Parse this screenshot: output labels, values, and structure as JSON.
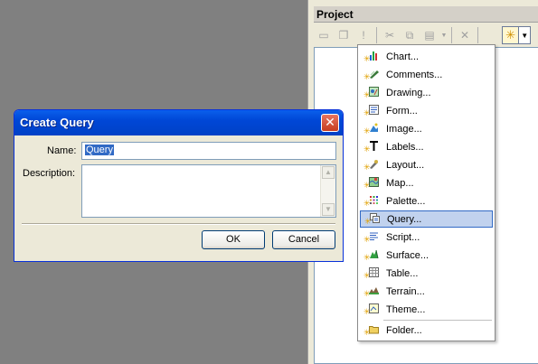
{
  "project_panel": {
    "title": "Project"
  },
  "new_menu": {
    "items": [
      {
        "label": "Chart...",
        "icon": "chart-icon"
      },
      {
        "label": "Comments...",
        "icon": "comments-icon"
      },
      {
        "label": "Drawing...",
        "icon": "drawing-icon"
      },
      {
        "label": "Form...",
        "icon": "form-icon"
      },
      {
        "label": "Image...",
        "icon": "image-icon"
      },
      {
        "label": "Labels...",
        "icon": "labels-icon"
      },
      {
        "label": "Layout...",
        "icon": "layout-icon"
      },
      {
        "label": "Map...",
        "icon": "map-icon"
      },
      {
        "label": "Palette...",
        "icon": "palette-icon"
      },
      {
        "label": "Query...",
        "icon": "query-icon",
        "selected": true
      },
      {
        "label": "Script...",
        "icon": "script-icon"
      },
      {
        "label": "Surface...",
        "icon": "surface-icon"
      },
      {
        "label": "Table...",
        "icon": "table-icon"
      },
      {
        "label": "Terrain...",
        "icon": "terrain-icon"
      },
      {
        "label": "Theme...",
        "icon": "theme-icon"
      },
      {
        "label": "Folder...",
        "icon": "folder-icon"
      }
    ]
  },
  "dialog": {
    "title": "Create Query",
    "close_glyph": "✕",
    "name_label": "Name:",
    "name_value": "Query",
    "description_label": "Description:",
    "description_value": "",
    "ok_label": "OK",
    "cancel_label": "Cancel"
  },
  "colors": {
    "titlebar_blue": "#0047d6",
    "selection_blue": "#316ac5",
    "menu_highlight": "#c1d2ee"
  }
}
